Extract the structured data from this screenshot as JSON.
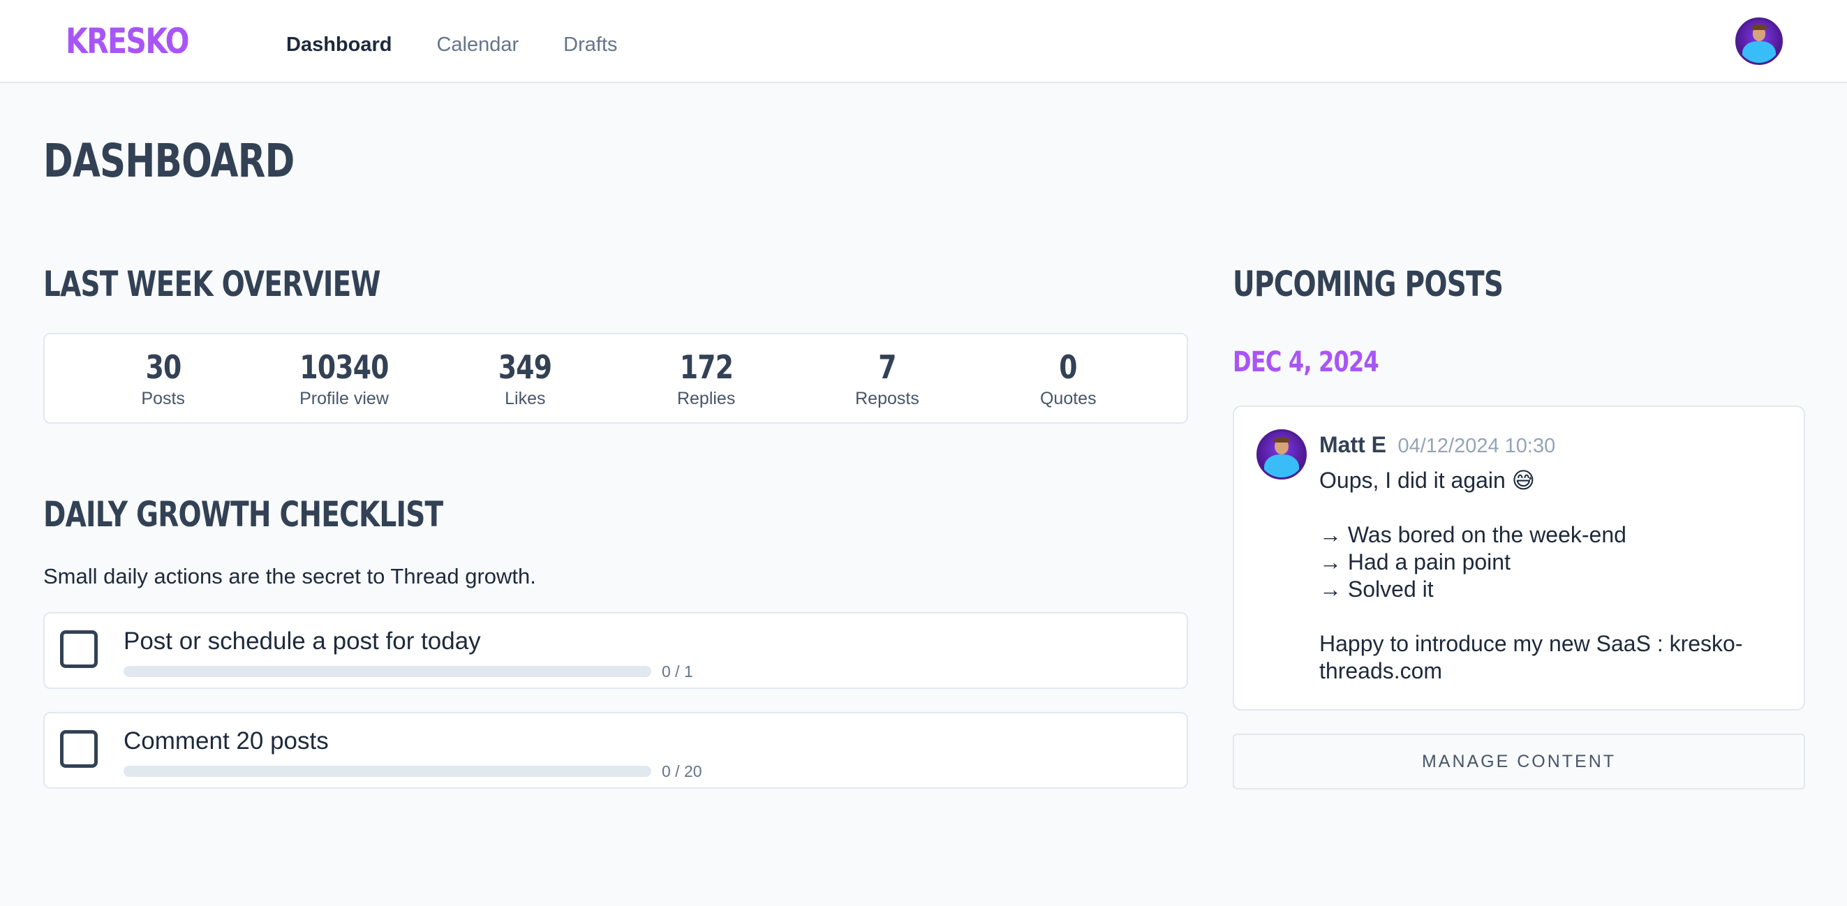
{
  "header": {
    "logo": "KRESKO",
    "nav": [
      {
        "label": "Dashboard",
        "active": true
      },
      {
        "label": "Calendar",
        "active": false
      },
      {
        "label": "Drafts",
        "active": false
      }
    ]
  },
  "page": {
    "title": "DASHBOARD"
  },
  "overview": {
    "title": "LAST WEEK OVERVIEW",
    "stats": [
      {
        "value": "30",
        "label": "Posts"
      },
      {
        "value": "10340",
        "label": "Profile view"
      },
      {
        "value": "349",
        "label": "Likes"
      },
      {
        "value": "172",
        "label": "Replies"
      },
      {
        "value": "7",
        "label": "Reposts"
      },
      {
        "value": "0",
        "label": "Quotes"
      }
    ]
  },
  "checklist": {
    "title": "DAILY GROWTH CHECKLIST",
    "description": "Small daily actions are the secret to Thread growth.",
    "items": [
      {
        "label": "Post or schedule a post for today",
        "progress_text": "0 / 1",
        "progress": 0
      },
      {
        "label": "Comment 20 posts",
        "progress_text": "0 / 20",
        "progress": 0
      }
    ]
  },
  "upcoming": {
    "title": "UPCOMING POSTS",
    "date": "DEC 4, 2024",
    "post": {
      "author": "Matt E",
      "timestamp": "04/12/2024 10:30",
      "line1": "Oups, I did it again 😅",
      "line2": "→ Was bored on the week-end",
      "line3": "→ Had a pain point",
      "line4": "→ Solved it",
      "line5": "Happy to introduce my new SaaS : kresko-threads.com"
    },
    "manage_label": "MANAGE CONTENT"
  },
  "colors": {
    "accent": "#a855f7",
    "text": "#334155",
    "border": "#e2e8f0"
  }
}
